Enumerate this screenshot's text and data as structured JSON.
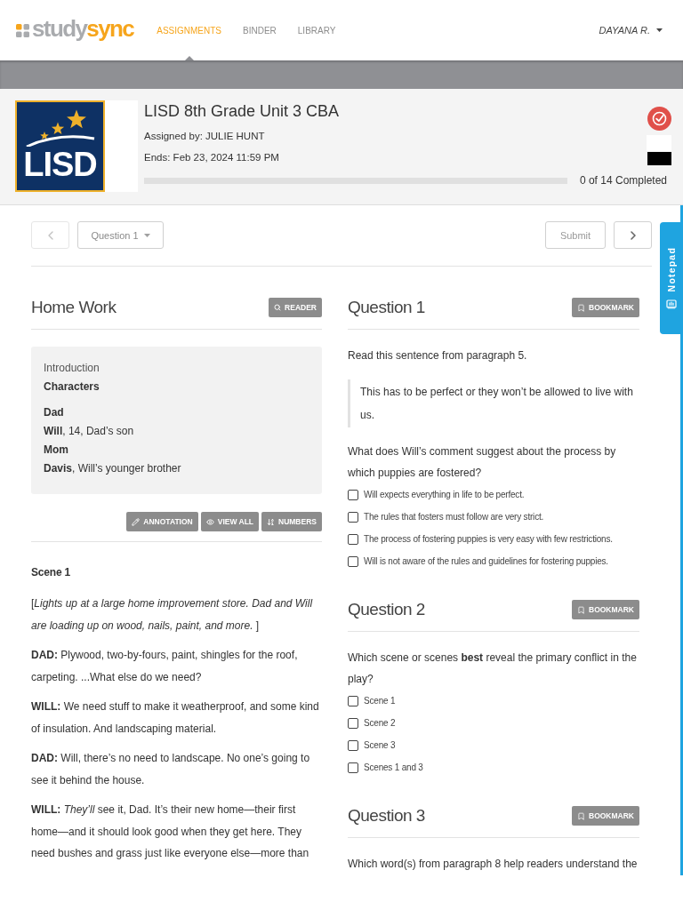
{
  "header": {
    "logo": {
      "prefix": "study",
      "suffix": "sync"
    },
    "tabs": [
      {
        "label": "ASSIGNMENTS",
        "selected": true
      },
      {
        "label": "BINDER",
        "selected": false
      },
      {
        "label": "LIBRARY",
        "selected": false
      }
    ],
    "user": "DAYANA R."
  },
  "assignment": {
    "school_logo": "LISD",
    "title": "LISD 8th Grade Unit 3 CBA",
    "assigned_by": "Assigned by: JULIE HUNT",
    "ends": "Ends: Feb 23, 2024 11:59 PM",
    "progress": {
      "reading": "0 of 14 Completed"
    }
  },
  "question_nav": {
    "prev": {
      "disabled": true
    },
    "question_select": "Question 1",
    "submit": "Submit",
    "next": {
      "disabled": false
    }
  },
  "notepad": {
    "label": "Notepad"
  },
  "reading": {
    "title": "Home Work",
    "reader_button": "READER",
    "intro": {
      "heading": "Introduction",
      "subheading": "Characters",
      "characters": [
        {
          "kind": "name",
          "text": "Dad"
        },
        {
          "kind": "entry",
          "text": "**Will**, 14, Dad’s son"
        },
        {
          "kind": "name",
          "text": "Mom"
        },
        {
          "kind": "entry",
          "text": "**Davis**, Will’s younger brother"
        }
      ]
    },
    "tools": [
      "ANNOTATION",
      "VIEW ALL",
      "NUMBERS"
    ],
    "scene": {
      "heading": "Scene 1",
      "paragraphs": [
        "[*Lights up at a large home improvement store. Dad and Will are loading up on wood, nails, paint, and more.* ]",
        "**DAD:** Plywood, two-by-fours, paint, shingles for the roof, carpeting. ...What else do we need?",
        "**WILL:** We need stuff to make it weatherproof, and some kind of insulation. And landscaping material.",
        "**DAD:** Will, there’s no need to landscape. No one’s going to see it behind the house.",
        "**WILL:** *They’ll* see it, Dad. It’s their new home—their first home—and it should look good when they get here. They need bushes and grass just like everyone else—more than"
      ]
    }
  },
  "questions": [
    {
      "title": "Question 1",
      "bookmark": "BOOKMARK",
      "passage_intro": "Read this sentence from paragraph 5.",
      "quote": "This has to be perfect or they won’t be allowed to live with us.",
      "prompt": "What does Will’s comment suggest about the process by which puppies are fostered?",
      "options": [
        {
          "label": "Will expects everything in life to be perfect.",
          "checked": false
        },
        {
          "label": "The rules that fosters must follow are very strict.",
          "checked": false
        },
        {
          "label": "The process of fostering puppies is very easy with few restrictions.",
          "checked": false
        },
        {
          "label": "Will is not aware of the rules and guidelines for fostering puppies.",
          "checked": false
        }
      ]
    },
    {
      "title": "Question 2",
      "bookmark": "BOOKMARK",
      "prompt": "Which scene or scenes **best** reveal the primary conflict in the play?",
      "options": [
        {
          "label": "Scene 1",
          "checked": false
        },
        {
          "label": "Scene 2",
          "checked": false
        },
        {
          "label": "Scene 3",
          "checked": false
        },
        {
          "label": "Scenes 1 and 3",
          "checked": false
        }
      ]
    },
    {
      "title": "Question 3",
      "bookmark": "BOOKMARK",
      "prompt": "Which word(s) from paragraph 8 help readers understand the"
    }
  ]
}
